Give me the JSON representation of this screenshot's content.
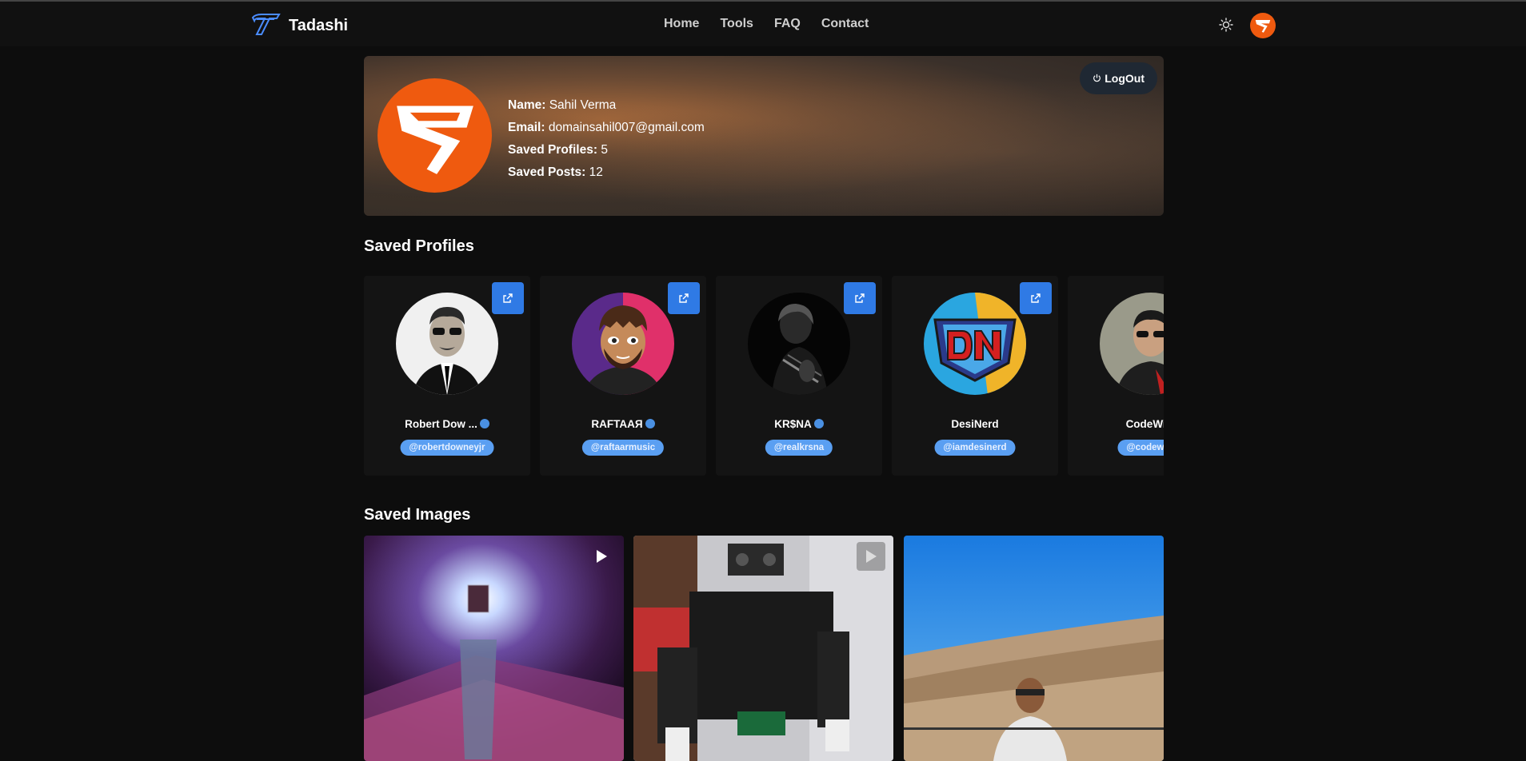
{
  "header": {
    "brand": "Tadashi",
    "nav": [
      "Home",
      "Tools",
      "FAQ",
      "Contact"
    ]
  },
  "profile": {
    "name_label": "Name:",
    "name": "Sahil Verma",
    "email_label": "Email:",
    "email": "domainsahil007@gmail.com",
    "saved_profiles_label": "Saved Profiles:",
    "saved_profiles": "5",
    "saved_posts_label": "Saved Posts:",
    "saved_posts": "12",
    "logout_label": "LogOut"
  },
  "saved_profiles_title": "Saved Profiles",
  "saved_profiles": [
    {
      "name": "Robert Dow ...",
      "handle": "@robertdowneyjr",
      "verified": true
    },
    {
      "name": "RAFTAAЯ",
      "handle": "@raftaarmusic",
      "verified": true
    },
    {
      "name": "KR$NA",
      "handle": "@realkrsna",
      "verified": true
    },
    {
      "name": "DesiNerd",
      "handle": "@iamdesinerd",
      "verified": false
    },
    {
      "name": "CodeWith",
      "handle": "@codewith",
      "verified": false
    }
  ],
  "saved_images_title": "Saved Images",
  "colors": {
    "accent": "#ef5a0f",
    "button_blue": "#2f7ae5",
    "handle_badge": "#5a9ff2"
  }
}
